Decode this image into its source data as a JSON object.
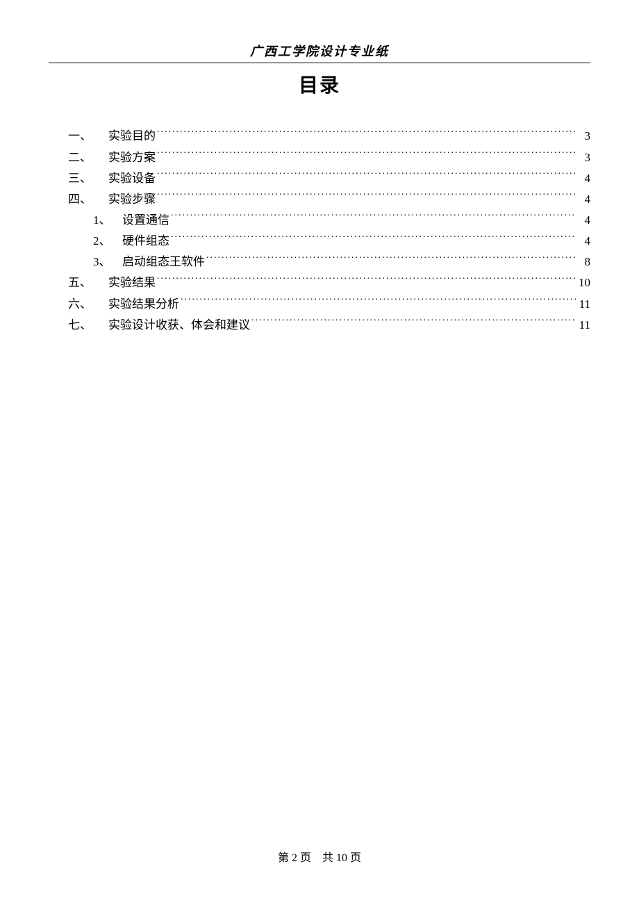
{
  "header": "广西工学院设计专业纸",
  "title": "目录",
  "toc": [
    {
      "num": "一、",
      "text": "实验目的",
      "page": "3",
      "level": 1
    },
    {
      "num": "二、",
      "text": "实验方案",
      "page": "3",
      "level": 1
    },
    {
      "num": "三、",
      "text": "实验设备",
      "page": "4",
      "level": 1
    },
    {
      "num": "四、",
      "text": "实验步骤",
      "page": "4",
      "level": 1
    },
    {
      "num": "1、",
      "text": "设置通信",
      "page": "4",
      "level": 2
    },
    {
      "num": "2、",
      "text": "硬件组态",
      "page": "4",
      "level": 2
    },
    {
      "num": "3、",
      "text": "启动组态王软件",
      "page": "8",
      "level": 2
    },
    {
      "num": "五、",
      "text": "实验结果",
      "page": "10",
      "level": 1
    },
    {
      "num": "六、",
      "text": "实验结果分析",
      "page": "11",
      "level": 1
    },
    {
      "num": "七、",
      "text": "实验设计收获、体会和建议",
      "page": "11",
      "level": 1
    }
  ],
  "footer": "第 2 页　共 10 页"
}
